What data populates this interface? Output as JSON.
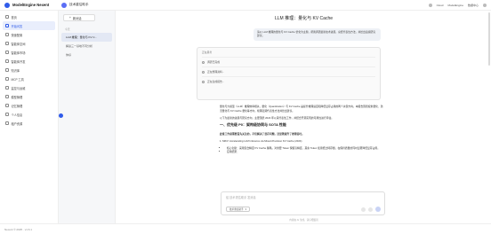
{
  "brand": {
    "name": "ModelEngine Nexent"
  },
  "app": {
    "title": "技术重估助手"
  },
  "top_right": {
    "items": [
      "Cloud",
      "ModelEngine",
      "数据中心"
    ]
  },
  "nav": [
    {
      "label": "首页",
      "icon": "home-icon"
    },
    {
      "label": "开始问答",
      "icon": "chat-icon",
      "active": true
    },
    {
      "label": "快速配置",
      "icon": "rocket-icon"
    },
    {
      "label": "智能体空间",
      "icon": "grid-icon"
    },
    {
      "label": "智能体市场",
      "icon": "store-icon"
    },
    {
      "label": "智能体开发",
      "icon": "code-icon"
    },
    {
      "label": "知识库",
      "icon": "book-icon"
    },
    {
      "label": "MCP 工具",
      "icon": "plug-icon"
    },
    {
      "label": "监控与运维",
      "icon": "monitor-icon"
    },
    {
      "label": "模型管理",
      "icon": "cube-icon"
    },
    {
      "label": "记忆管理",
      "icon": "memory-icon"
    },
    {
      "label": "个人信息",
      "icon": "user-icon"
    },
    {
      "label": "租户资源",
      "icon": "tenant-icon"
    }
  ],
  "conversations": {
    "new_label": "新对话",
    "section": "今天",
    "items": [
      {
        "label": "LLM 推理：量化与 KV C...",
        "active": true
      },
      {
        "label": "解读三一基地不同分析"
      },
      {
        "label": "你好"
      }
    ]
  },
  "chat": {
    "title": "LLM 推理：量化与 KV Cache",
    "user_message": "请以 LLM 推理的量化与 KV Cache 优化为主题，帮我调研最新技术进展，总结代表性方法，并给出后续研究建议。",
    "think": {
      "header": "正在思考",
      "steps": [
        "调研已完成",
        "正在整理资料...",
        "正在生成报告..."
      ]
    },
    "answer": {
      "intro": "量化与大模型（LLM）推理效率相关，量化（Quantization）与 KV Cache 是提升推理速度和降低显存占用的两个关键方向。本报告围绕权重量化、激活量化与 KV Cache 量化等方向，梳理近期代表性方法并给出建议。",
      "intro2": "以下为最新的进展与研究方向，主要围绕 2024 年以来代表性工作，并结合开源实现的可用性进行评估。",
      "section_title": "一、优先级 P0：架构级协同与 SOTA 性能",
      "section_sub": "此章工作是需要首先关注的，不仅解决了显存问题，还显著提升了推理吞吐。",
      "subheading": "1. MiKV: Accelerating LLM Inference via Mixed-Precision KV Cache (2024)",
      "bullets": [
        "核心创新：采用混合精度 KV Cache 策略，对重要 Token 保留高精度，其余 Token 使用低比特存储，在保持质量的同时显著降低显存占用。",
        "应用结果："
      ]
    },
    "input": {
      "placeholder": "给 技术重估助手 发消息",
      "chip": "技术重估助手"
    },
    "disclaimer": "内容由 AI 生成，请仔细甄别"
  },
  "footer": {
    "text": "Nexent © 2025 · v1.6.1"
  }
}
